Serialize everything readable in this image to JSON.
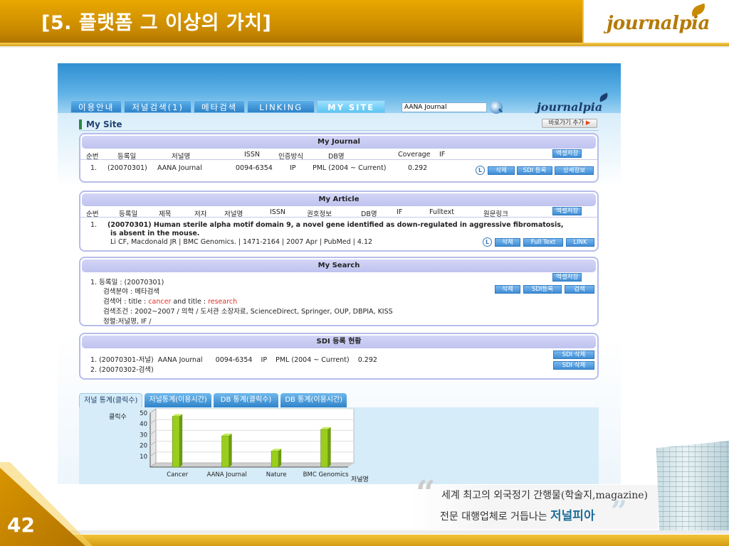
{
  "slide": {
    "title": "[5. 플랫폼 그 이상의 가치]",
    "logo": "journalpia",
    "page_number": "42",
    "tagline_line1": "세계 최고의 외국정기 간행물(학술지,magazine)",
    "tagline_line2_prefix": "전문 대행업체로 거듭나는 ",
    "tagline_brand": "저널피아"
  },
  "nav": {
    "tabs": [
      "이용안내",
      "저널검색(1)",
      "메타검색",
      "LINKING",
      "MY SITE"
    ],
    "search_value": "AANA Journal",
    "logo": "journalpia"
  },
  "mysite": {
    "title": "My Site",
    "shortcut": "바로가기 추가",
    "shortcut_arrow": "▶"
  },
  "my_journal": {
    "title": "My Journal",
    "export": "엑셀저장",
    "columns": [
      "순번",
      "등록일",
      "저널명",
      "ISSN",
      "인증방식",
      "DB명",
      "Coverage",
      "IF"
    ],
    "row": {
      "no": "1.",
      "date": "(20070301)",
      "name": "AANA Journal",
      "issn": "0094-6354",
      "auth": "IP",
      "db": "PML (2004 ~ Current)",
      "if": "0.292"
    },
    "buttons": [
      "삭제",
      "SDI 등록",
      "상세정보"
    ]
  },
  "my_article": {
    "title": "My Article",
    "export": "엑셀저장",
    "columns": [
      "순번",
      "등록일",
      "제목",
      "저자",
      "저널명",
      "ISSN",
      "권호정보",
      "DB명",
      "IF",
      "Fulltext",
      "원문링크"
    ],
    "row": {
      "no": "1.",
      "line1": "(20070301)  Human sterile alpha motif domain 9, a novel gene identified as down-regulated in aggressive fibromatosis,",
      "line2": "is absent in the mouse.",
      "line3": "Li CF, Macdonald JR | BMC Genomics. | 1471-2164 | 2007 Apr | PubMed | 4.12"
    },
    "buttons": [
      "삭제",
      "Full Text",
      "LINK"
    ]
  },
  "my_search": {
    "title": "My Search",
    "export": "엑셀저장",
    "date_line": "1. 등록일 : (20070301)",
    "field_line": "검색분야 : 메타검색",
    "query_prefix": "검색어 : title : ",
    "query_term1": "cancer",
    "query_mid": " and title : ",
    "query_term2": "research",
    "cond_line": "검색조건 : 2002~2007 / 의학 / 도서관 소장자료, ScienceDirect, Springer, OUP, DBPIA, KISS",
    "sort_line": "정렬:저널명, IF /",
    "buttons": [
      "삭제",
      "SDI등록",
      "검색"
    ]
  },
  "sdi": {
    "title": "SDI 등록 현황",
    "rows": [
      "1. (20070301-저널)  AANA Journal      0094-6354    IP    PML (2004 ~ Current)    0.292",
      "2. (20070302-검색)"
    ],
    "buttons": [
      "SDI 삭제",
      "SDI 삭제"
    ]
  },
  "stats": {
    "tabs": [
      "저널 통계(클릭수)",
      "저널통계(이용시간)",
      "DB 통계(클릭수)",
      "DB 통계(이용시간)"
    ]
  },
  "chart_data": {
    "type": "bar",
    "categories": [
      "Cancer",
      "AANA Journal",
      "Nature",
      "BMC Genomics"
    ],
    "values": [
      47,
      29,
      15,
      35
    ],
    "ylabel": "클릭수",
    "xlabel": "저널명",
    "ylim": [
      0,
      50
    ],
    "yticks": [
      10,
      20,
      30,
      40,
      50
    ],
    "bar_color": "#9acd1e"
  },
  "colors": {
    "header_gold": "#c98a00",
    "nav_blue": "#2f83c9",
    "panel_border": "#b7bdea",
    "button_blue": "#3f8ed6"
  }
}
